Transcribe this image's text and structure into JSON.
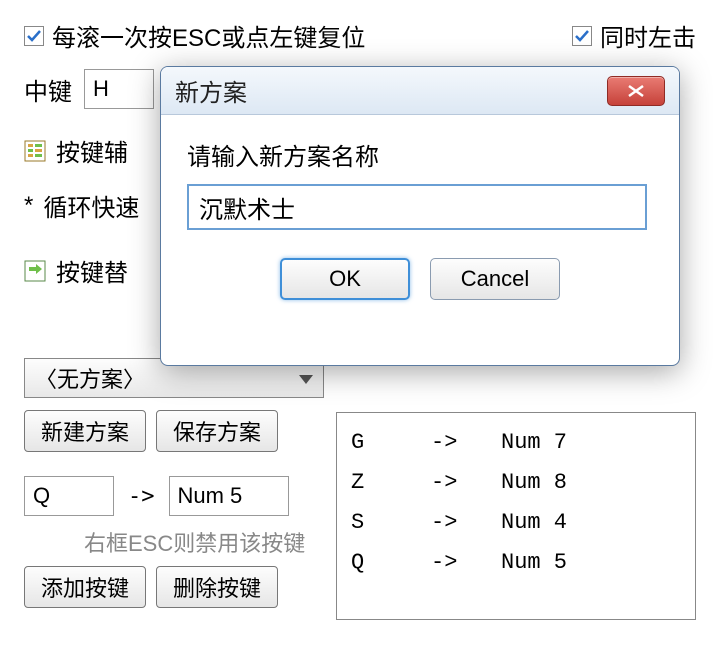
{
  "topRow": {
    "escResetLabel": "每滚一次按ESC或点左键复位",
    "leftClickLabel": "同时左击"
  },
  "middleKey": {
    "label": "中键",
    "value": "H"
  },
  "sections": {
    "assist": "按键辅",
    "cycle": "循环快速",
    "replace": "按键替"
  },
  "dropdown": {
    "selected": "〈无方案〉"
  },
  "buttons": {
    "newScheme": "新建方案",
    "saveScheme": "保存方案",
    "addKey": "添加按键",
    "deleteKey": "删除按键"
  },
  "mapping": {
    "from": "Q",
    "to": "Num 5",
    "arrow": "->"
  },
  "helper": "右框ESC则禁用该按键",
  "list": [
    {
      "from": "G",
      "arrow": "->",
      "to": "Num 7"
    },
    {
      "from": "Z",
      "arrow": "->",
      "to": "Num 8"
    },
    {
      "from": "S",
      "arrow": "->",
      "to": "Num 4"
    },
    {
      "from": "Q",
      "arrow": "->",
      "to": "Num 5"
    }
  ],
  "dialog": {
    "title": "新方案",
    "prompt": "请输入新方案名称",
    "value": "沉默术士",
    "ok": "OK",
    "cancel": "Cancel"
  }
}
